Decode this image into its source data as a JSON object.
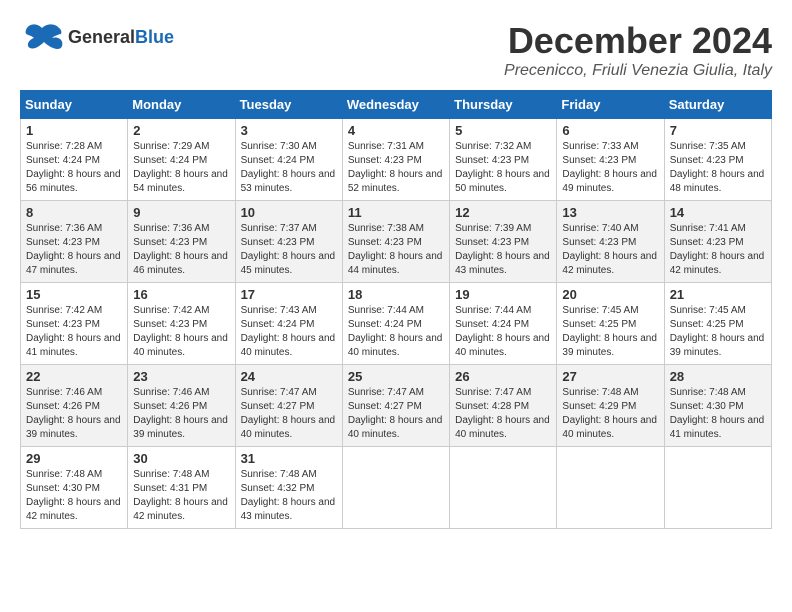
{
  "header": {
    "logo_general": "General",
    "logo_blue": "Blue",
    "month_title": "December 2024",
    "location": "Precenicco, Friuli Venezia Giulia, Italy"
  },
  "calendar": {
    "days_of_week": [
      "Sunday",
      "Monday",
      "Tuesday",
      "Wednesday",
      "Thursday",
      "Friday",
      "Saturday"
    ],
    "weeks": [
      [
        {
          "day": "1",
          "sunrise": "7:28 AM",
          "sunset": "4:24 PM",
          "daylight": "8 hours and 56 minutes."
        },
        {
          "day": "2",
          "sunrise": "7:29 AM",
          "sunset": "4:24 PM",
          "daylight": "8 hours and 54 minutes."
        },
        {
          "day": "3",
          "sunrise": "7:30 AM",
          "sunset": "4:24 PM",
          "daylight": "8 hours and 53 minutes."
        },
        {
          "day": "4",
          "sunrise": "7:31 AM",
          "sunset": "4:23 PM",
          "daylight": "8 hours and 52 minutes."
        },
        {
          "day": "5",
          "sunrise": "7:32 AM",
          "sunset": "4:23 PM",
          "daylight": "8 hours and 50 minutes."
        },
        {
          "day": "6",
          "sunrise": "7:33 AM",
          "sunset": "4:23 PM",
          "daylight": "8 hours and 49 minutes."
        },
        {
          "day": "7",
          "sunrise": "7:35 AM",
          "sunset": "4:23 PM",
          "daylight": "8 hours and 48 minutes."
        }
      ],
      [
        {
          "day": "8",
          "sunrise": "7:36 AM",
          "sunset": "4:23 PM",
          "daylight": "8 hours and 47 minutes."
        },
        {
          "day": "9",
          "sunrise": "7:36 AM",
          "sunset": "4:23 PM",
          "daylight": "8 hours and 46 minutes."
        },
        {
          "day": "10",
          "sunrise": "7:37 AM",
          "sunset": "4:23 PM",
          "daylight": "8 hours and 45 minutes."
        },
        {
          "day": "11",
          "sunrise": "7:38 AM",
          "sunset": "4:23 PM",
          "daylight": "8 hours and 44 minutes."
        },
        {
          "day": "12",
          "sunrise": "7:39 AM",
          "sunset": "4:23 PM",
          "daylight": "8 hours and 43 minutes."
        },
        {
          "day": "13",
          "sunrise": "7:40 AM",
          "sunset": "4:23 PM",
          "daylight": "8 hours and 42 minutes."
        },
        {
          "day": "14",
          "sunrise": "7:41 AM",
          "sunset": "4:23 PM",
          "daylight": "8 hours and 42 minutes."
        }
      ],
      [
        {
          "day": "15",
          "sunrise": "7:42 AM",
          "sunset": "4:23 PM",
          "daylight": "8 hours and 41 minutes."
        },
        {
          "day": "16",
          "sunrise": "7:42 AM",
          "sunset": "4:23 PM",
          "daylight": "8 hours and 40 minutes."
        },
        {
          "day": "17",
          "sunrise": "7:43 AM",
          "sunset": "4:24 PM",
          "daylight": "8 hours and 40 minutes."
        },
        {
          "day": "18",
          "sunrise": "7:44 AM",
          "sunset": "4:24 PM",
          "daylight": "8 hours and 40 minutes."
        },
        {
          "day": "19",
          "sunrise": "7:44 AM",
          "sunset": "4:24 PM",
          "daylight": "8 hours and 40 minutes."
        },
        {
          "day": "20",
          "sunrise": "7:45 AM",
          "sunset": "4:25 PM",
          "daylight": "8 hours and 39 minutes."
        },
        {
          "day": "21",
          "sunrise": "7:45 AM",
          "sunset": "4:25 PM",
          "daylight": "8 hours and 39 minutes."
        }
      ],
      [
        {
          "day": "22",
          "sunrise": "7:46 AM",
          "sunset": "4:26 PM",
          "daylight": "8 hours and 39 minutes."
        },
        {
          "day": "23",
          "sunrise": "7:46 AM",
          "sunset": "4:26 PM",
          "daylight": "8 hours and 39 minutes."
        },
        {
          "day": "24",
          "sunrise": "7:47 AM",
          "sunset": "4:27 PM",
          "daylight": "8 hours and 40 minutes."
        },
        {
          "day": "25",
          "sunrise": "7:47 AM",
          "sunset": "4:27 PM",
          "daylight": "8 hours and 40 minutes."
        },
        {
          "day": "26",
          "sunrise": "7:47 AM",
          "sunset": "4:28 PM",
          "daylight": "8 hours and 40 minutes."
        },
        {
          "day": "27",
          "sunrise": "7:48 AM",
          "sunset": "4:29 PM",
          "daylight": "8 hours and 40 minutes."
        },
        {
          "day": "28",
          "sunrise": "7:48 AM",
          "sunset": "4:30 PM",
          "daylight": "8 hours and 41 minutes."
        }
      ],
      [
        {
          "day": "29",
          "sunrise": "7:48 AM",
          "sunset": "4:30 PM",
          "daylight": "8 hours and 42 minutes."
        },
        {
          "day": "30",
          "sunrise": "7:48 AM",
          "sunset": "4:31 PM",
          "daylight": "8 hours and 42 minutes."
        },
        {
          "day": "31",
          "sunrise": "7:48 AM",
          "sunset": "4:32 PM",
          "daylight": "8 hours and 43 minutes."
        },
        null,
        null,
        null,
        null
      ]
    ]
  }
}
